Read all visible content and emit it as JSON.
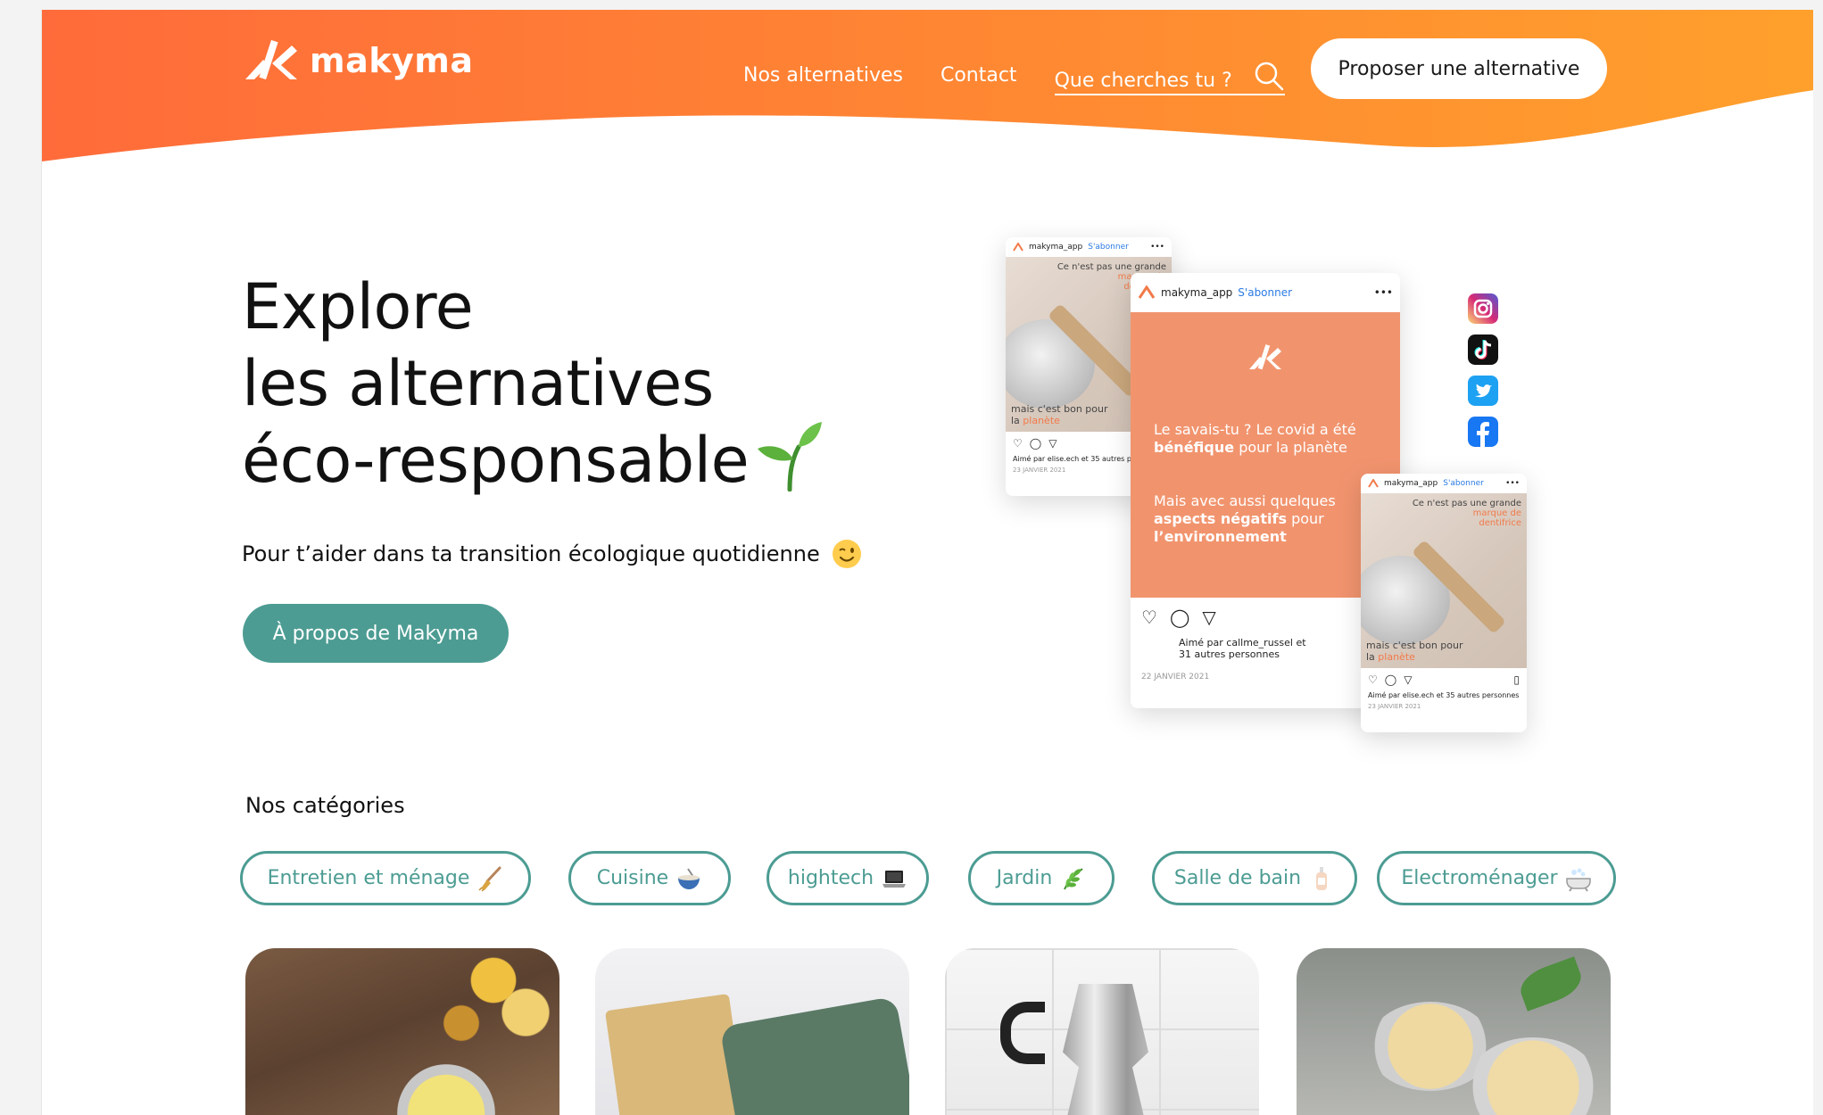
{
  "brand": {
    "name": "makyma",
    "orange_start": "#ff6b3a",
    "orange_end": "#ffa02c",
    "teal": "#4c9c93"
  },
  "nav": {
    "links": [
      "Nos alternatives",
      "Contact"
    ],
    "search_placeholder": "Que cherches tu ?",
    "cta_label": "Proposer une alternative"
  },
  "hero": {
    "title_lines": [
      "Explore",
      "les alternatives",
      "éco-responsable"
    ],
    "subtitle": "Pour t’aider dans ta transition écologique quotidienne",
    "button_label": "À propos de Makyma"
  },
  "mockups": {
    "account": "makyma_app",
    "follow": "S'abonner",
    "side_post": {
      "top_text": [
        "Ce n'est pas une grande",
        "marque de",
        "dentifrice"
      ],
      "bottom_text_plain": "mais c'est bon pour",
      "bottom_text_prefix": "la",
      "bottom_text_accent": "planète",
      "likes": "Aimé par elise.ech et 35 autres personnes",
      "date": "23 JANVIER 2021"
    },
    "main_post": {
      "line1": "Le savais-tu ? Le covid a été",
      "line2_bold": "bénéfique",
      "line2_rest": "pour la planète",
      "line3": "Mais avec aussi quelques",
      "line4_bold": "aspects négatifs",
      "line4_rest": "pour",
      "line5_bold": "l’environnement",
      "likes_line1": "Aimé par callme_russel et",
      "likes_line2": "31 autres personnes",
      "date": "22 JANVIER 2021"
    },
    "social_icons": [
      "instagram-icon",
      "tiktok-icon",
      "twitter-icon",
      "facebook-icon"
    ]
  },
  "categories": {
    "title": "Nos catégories",
    "items": [
      {
        "label": "Entretien et ménage",
        "icon": "broom-icon"
      },
      {
        "label": "Cuisine",
        "icon": "bowl-icon"
      },
      {
        "label": "hightech",
        "icon": "laptop-icon"
      },
      {
        "label": "Jardin",
        "icon": "herb-icon"
      },
      {
        "label": "Salle de bain",
        "icon": "lotion-bottle-icon"
      },
      {
        "label": "Electroménager",
        "icon": "bathtub-icon"
      }
    ]
  },
  "cards": [
    "flowers-wax-image",
    "soap-image",
    "coffee-maker-image",
    "balm-tins-image"
  ]
}
